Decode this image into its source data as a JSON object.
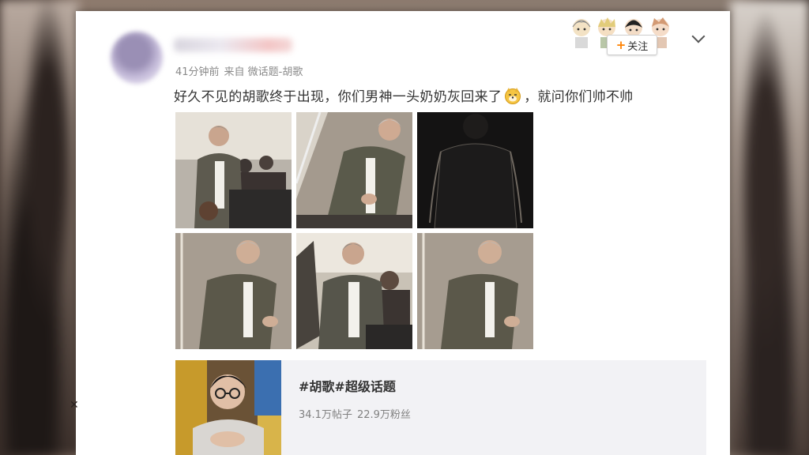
{
  "post": {
    "time": "41分钟前",
    "source": "来自 微话题-胡歌",
    "text_before": "好久不见的胡歌终于出现，你们男神一头奶奶灰回来了",
    "emoji": "doge-emoji",
    "text_after": "，就问你们帅不帅",
    "follow_plus": "+",
    "follow_label": "关注"
  },
  "topic": {
    "title": "#胡歌#超级话题",
    "posts": "34.1万帖子",
    "fans": "22.9万粉丝"
  },
  "colors": {
    "accent": "#ff8200",
    "text": "#333333",
    "meta": "#8a8a8a"
  }
}
